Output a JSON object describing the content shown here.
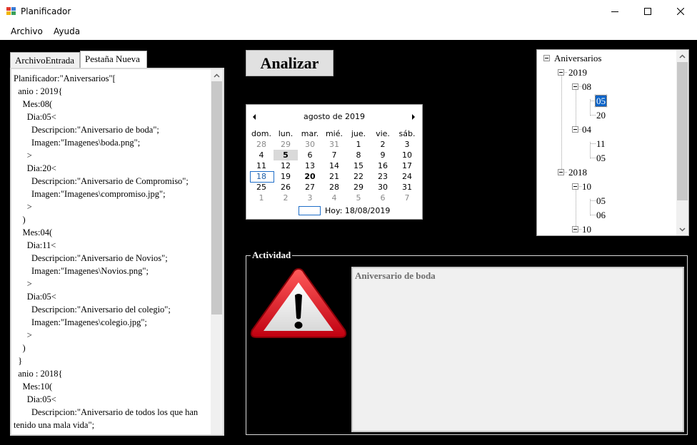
{
  "window": {
    "title": "Planificador",
    "app_icon": "windows-form-icon",
    "controls": [
      "minimize-icon",
      "maximize-icon",
      "close-icon"
    ]
  },
  "menu": {
    "items": [
      "Archivo",
      "Ayuda"
    ]
  },
  "tabs": {
    "items": [
      "ArchivoEntrada",
      "Pestaña Nueva"
    ],
    "active": "Pestaña Nueva"
  },
  "editor": {
    "text": "Planificador:\"Aniversarios\"[\n  anio : 2019{\n    Mes:08(\n      Dia:05<\n        Descripcion:\"Aniversario de boda\";\n        Imagen:\"Imagenes\\boda.png\";\n      >\n      Dia:20<\n        Descripcion:\"Aniversario de Compromiso\";\n        Imagen:\"Imagenes\\compromiso.jpg\";\n      >\n    )\n    Mes:04(\n      Dia:11<\n        Descripcion:\"Aniversario de Novios\";\n        Imagen:\"Imagenes\\Novios.png\";\n      >\n      Dia:05<\n        Descripcion:\"Aniversario del colegio\";\n        Imagen:\"Imagenes\\colegio.jpg\";\n      >\n    )\n  }\n  anio : 2018{\n    Mes:10(\n      Dia:05<\n        Descripcion:\"Aniversario de todos los que han tenido una mala vida\";"
  },
  "toolbar": {
    "analizar_label": "Analizar"
  },
  "calendar": {
    "month_label": "agosto de 2019",
    "weekdays": [
      "dom.",
      "lun.",
      "mar.",
      "mié.",
      "jue.",
      "vie.",
      "sáb."
    ],
    "weeks": [
      [
        {
          "d": "28",
          "o": 1
        },
        {
          "d": "29",
          "o": 1
        },
        {
          "d": "30",
          "o": 1
        },
        {
          "d": "31",
          "o": 1
        },
        {
          "d": "1"
        },
        {
          "d": "2"
        },
        {
          "d": "3"
        }
      ],
      [
        {
          "d": "4"
        },
        {
          "d": "5",
          "b": 1,
          "s": 1
        },
        {
          "d": "6"
        },
        {
          "d": "7"
        },
        {
          "d": "8"
        },
        {
          "d": "9"
        },
        {
          "d": "10"
        }
      ],
      [
        {
          "d": "11"
        },
        {
          "d": "12"
        },
        {
          "d": "13"
        },
        {
          "d": "14"
        },
        {
          "d": "15"
        },
        {
          "d": "16"
        },
        {
          "d": "17"
        }
      ],
      [
        {
          "d": "18",
          "t": 1
        },
        {
          "d": "19"
        },
        {
          "d": "20",
          "b": 1
        },
        {
          "d": "21"
        },
        {
          "d": "22"
        },
        {
          "d": "23"
        },
        {
          "d": "24"
        }
      ],
      [
        {
          "d": "25"
        },
        {
          "d": "26"
        },
        {
          "d": "27"
        },
        {
          "d": "28"
        },
        {
          "d": "29"
        },
        {
          "d": "30"
        },
        {
          "d": "31"
        }
      ],
      [
        {
          "d": "1",
          "o": 1
        },
        {
          "d": "2",
          "o": 1
        },
        {
          "d": "3",
          "o": 1
        },
        {
          "d": "4",
          "o": 1
        },
        {
          "d": "5",
          "o": 1
        },
        {
          "d": "6",
          "o": 1
        },
        {
          "d": "7",
          "o": 1
        }
      ]
    ],
    "today_label": "Hoy: 18/08/2019"
  },
  "tree": {
    "root": "Aniversarios",
    "year_2019": "2019",
    "month_2019_08": "08",
    "day_2019_08_05": "05",
    "day_2019_08_20": "20",
    "month_2019_04": "04",
    "day_2019_04_11": "11",
    "day_2019_04_05": "05",
    "year_2018": "2018",
    "month_2018_10": "10",
    "day_2018_10_05": "05",
    "day_2018_10_06": "06",
    "month_2018_10b": "10",
    "selected": "05"
  },
  "activity": {
    "label": "Actividad",
    "description": "Aniversario de boda",
    "icon": "warning-icon"
  },
  "colors": {
    "background": "#000000",
    "selection": "#0a64c8",
    "warning_red": "#e0141e"
  }
}
